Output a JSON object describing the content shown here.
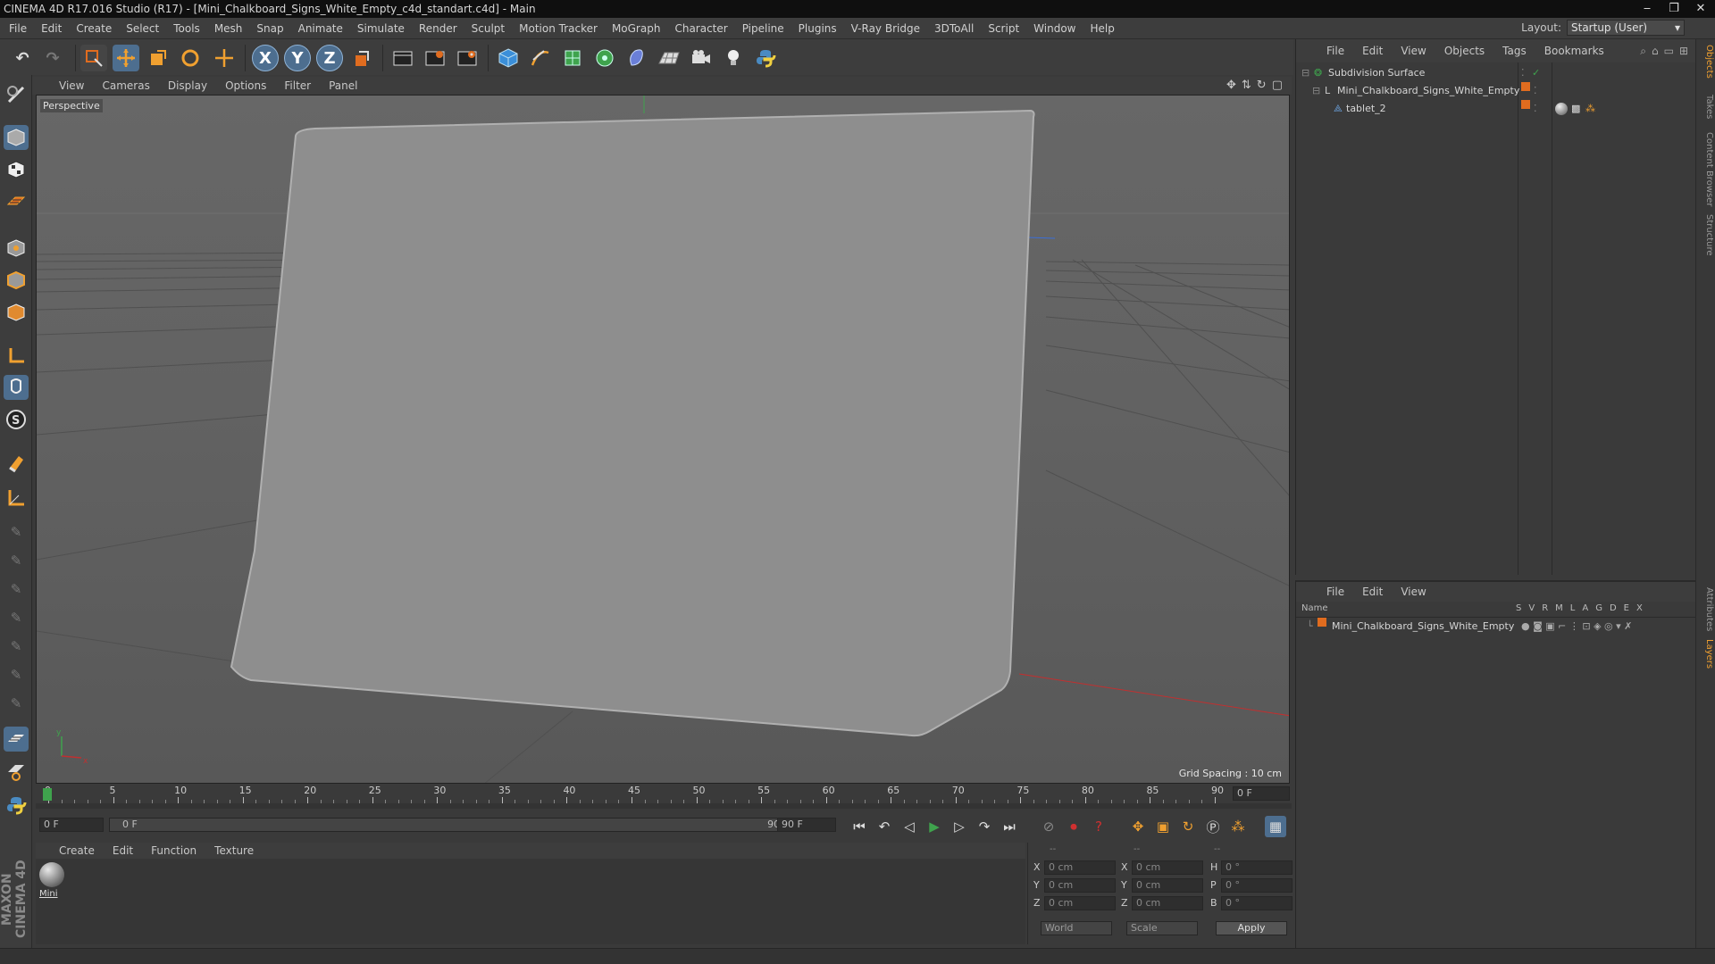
{
  "window": {
    "title": "CINEMA 4D R17.016 Studio (R17) - [Mini_Chalkboard_Signs_White_Empty_c4d_standart.c4d] - Main"
  },
  "menubar": [
    "File",
    "Edit",
    "Create",
    "Select",
    "Tools",
    "Mesh",
    "Snap",
    "Animate",
    "Simulate",
    "Render",
    "Sculpt",
    "Motion Tracker",
    "MoGraph",
    "Character",
    "Pipeline",
    "Plugins",
    "V-Ray Bridge",
    "3DToAll",
    "Script",
    "Window",
    "Help"
  ],
  "layout": {
    "label": "Layout:",
    "value": "Startup (User)"
  },
  "toolbar": {
    "axis_x": "X",
    "axis_y": "Y",
    "axis_z": "Z"
  },
  "viewport": {
    "menu": [
      "View",
      "Cameras",
      "Display",
      "Options",
      "Filter",
      "Panel"
    ],
    "label": "Perspective",
    "grid_spacing": "Grid Spacing : 10 cm"
  },
  "timeline": {
    "ticks": [
      "0",
      "5",
      "10",
      "15",
      "20",
      "25",
      "30",
      "35",
      "40",
      "45",
      "50",
      "55",
      "60",
      "65",
      "70",
      "75",
      "80",
      "85",
      "90"
    ],
    "frame_display": "0 F"
  },
  "transport": {
    "start_field": "0 F",
    "range_start": "0 F",
    "range_end": "90 F",
    "end_field": "90 F"
  },
  "material_manager": {
    "menu": [
      "Create",
      "Edit",
      "Function",
      "Texture"
    ],
    "material_label": "Mini"
  },
  "coordinates": {
    "headers": [
      "--",
      "--",
      "--"
    ],
    "rows": [
      {
        "a": "X",
        "a_val": "0 cm",
        "b": "X",
        "b_val": "0 cm",
        "c": "H",
        "c_val": "0 °"
      },
      {
        "a": "Y",
        "a_val": "0 cm",
        "b": "Y",
        "b_val": "0 cm",
        "c": "P",
        "c_val": "0 °"
      },
      {
        "a": "Z",
        "a_val": "0 cm",
        "b": "Z",
        "b_val": "0 cm",
        "c": "B",
        "c_val": "0 °"
      }
    ],
    "world": "World",
    "scale": "Scale",
    "apply": "Apply"
  },
  "objects_panel": {
    "menu": [
      "File",
      "Edit",
      "View",
      "Objects",
      "Tags",
      "Bookmarks"
    ],
    "items": [
      {
        "name": "Subdivision Surface"
      },
      {
        "name": "Mini_Chalkboard_Signs_White_Empty"
      },
      {
        "name": "tablet_2"
      }
    ]
  },
  "layers_panel": {
    "menu": [
      "File",
      "Edit",
      "View"
    ],
    "columns": {
      "name": "Name",
      "flags": [
        "S",
        "V",
        "R",
        "M",
        "L",
        "A",
        "G",
        "D",
        "E",
        "X"
      ]
    },
    "items": [
      {
        "name": "Mini_Chalkboard_Signs_White_Empty"
      }
    ]
  },
  "side_tabs": [
    "Objects",
    "Takes",
    "Content Browser",
    "Structure",
    "Attributes",
    "Layers"
  ],
  "maxon_logo": "MAXON CINEMA 4D",
  "colors": {
    "accent_orange": "#e06c1f",
    "accent_blue": "#3b8fd9",
    "background": "#3a3a3a"
  }
}
